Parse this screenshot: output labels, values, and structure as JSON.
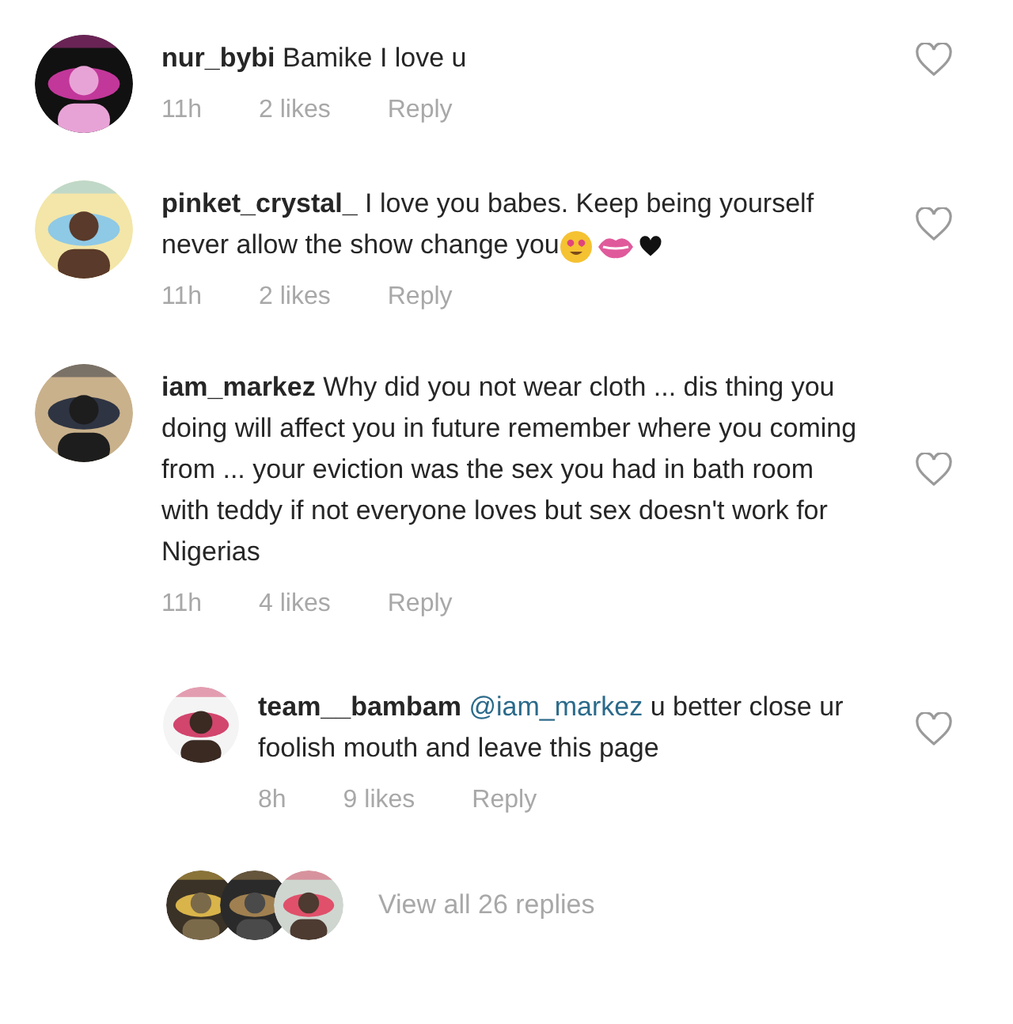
{
  "comments": [
    {
      "username": "nur_bybi",
      "text": "Bamike I love u",
      "time": "11h",
      "likes": "2 likes",
      "reply": "Reply",
      "liked": false
    },
    {
      "username": "pinket_crystal_",
      "text": "I love you babes. Keep being yourself never allow the show change you",
      "time": "11h",
      "likes": "2 likes",
      "reply": "Reply",
      "liked": false,
      "emojis": [
        {
          "kind": "heart_eyes"
        },
        {
          "kind": "kiss"
        },
        {
          "kind": "heart"
        }
      ]
    },
    {
      "username": "iam_markez",
      "text": "Why did you not wear cloth ... dis thing you doing will affect you in future remember where you coming from ... your eviction was the sex you had in bath room with teddy if not everyone loves but sex doesn't work for Nigerias",
      "time": "11h",
      "likes": "4 likes",
      "reply": "Reply",
      "liked": false,
      "replies": [
        {
          "username": "team__bambam",
          "mention": "@iam_markez",
          "text": "u better close ur foolish mouth and leave this page",
          "time": "8h",
          "likes": "9 likes",
          "reply": "Reply",
          "liked": false
        }
      ],
      "view_replies": "View all 26 replies"
    }
  ]
}
